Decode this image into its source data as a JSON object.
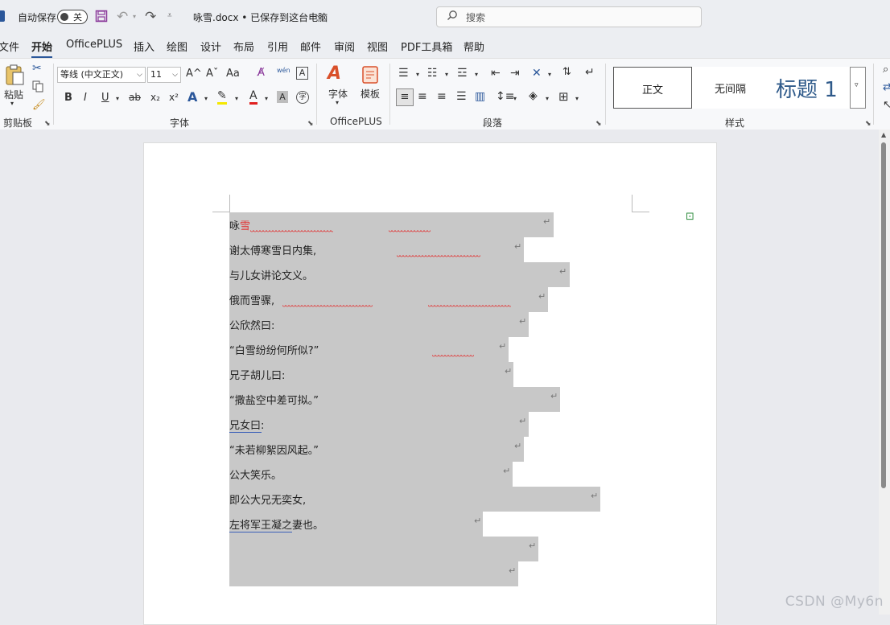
{
  "titlebar": {
    "autosave_label": "自动保存",
    "autosave_state": "关",
    "document_title": "咏雪.docx • 已保存到这台电脑",
    "title_dropdown_icon": "chevron-down-icon",
    "search_placeholder": "搜索"
  },
  "menu": {
    "items": [
      "文件",
      "开始",
      "OfficePLUS",
      "插入",
      "绘图",
      "设计",
      "布局",
      "引用",
      "邮件",
      "审阅",
      "视图",
      "PDF工具箱",
      "帮助"
    ],
    "active": "开始"
  },
  "ribbon": {
    "clipboard": {
      "paste_label": "粘贴",
      "group_label": "剪贴板"
    },
    "font": {
      "font_name": "等线 (中文正文)",
      "font_size": "11",
      "group_label": "字体",
      "buttons": {
        "bold": "B",
        "italic": "I",
        "underline": "U",
        "strike": "ab",
        "subscript": "x₂",
        "superscript": "x²",
        "grow": "A^",
        "shrink": "Aˇ",
        "case": "Aa",
        "phonetic": "wén"
      }
    },
    "officeplus": {
      "font_label": "字体",
      "template_label": "模板",
      "group_label": "OfficePLUS"
    },
    "paragraph": {
      "group_label": "段落"
    },
    "styles": {
      "group_label": "样式",
      "items": [
        "正文",
        "无间隔",
        "标题 1"
      ]
    }
  },
  "document": {
    "lines": [
      "咏雪",
      "谢太傅寒雪日内集,",
      "与儿女讲论文义。",
      "俄而雪骤,",
      "公欣然曰:",
      "“白雪纷纷何所似?”",
      "兄子胡儿曰:",
      "“撒盐空中差可拟。”",
      "兄女曰:",
      "“未若柳絮因风起。”",
      "公大笑乐。",
      "即公大兄无奕女,",
      "左将军王凝之妻也。",
      "",
      ""
    ],
    "pilcrow": "↵"
  },
  "watermark": "CSDN @My6n",
  "colors": {
    "accent": "#2b579a",
    "selection": "#c8c8c8",
    "spell_error": "#e03a3a",
    "save_icon": "#8b3a9b"
  }
}
